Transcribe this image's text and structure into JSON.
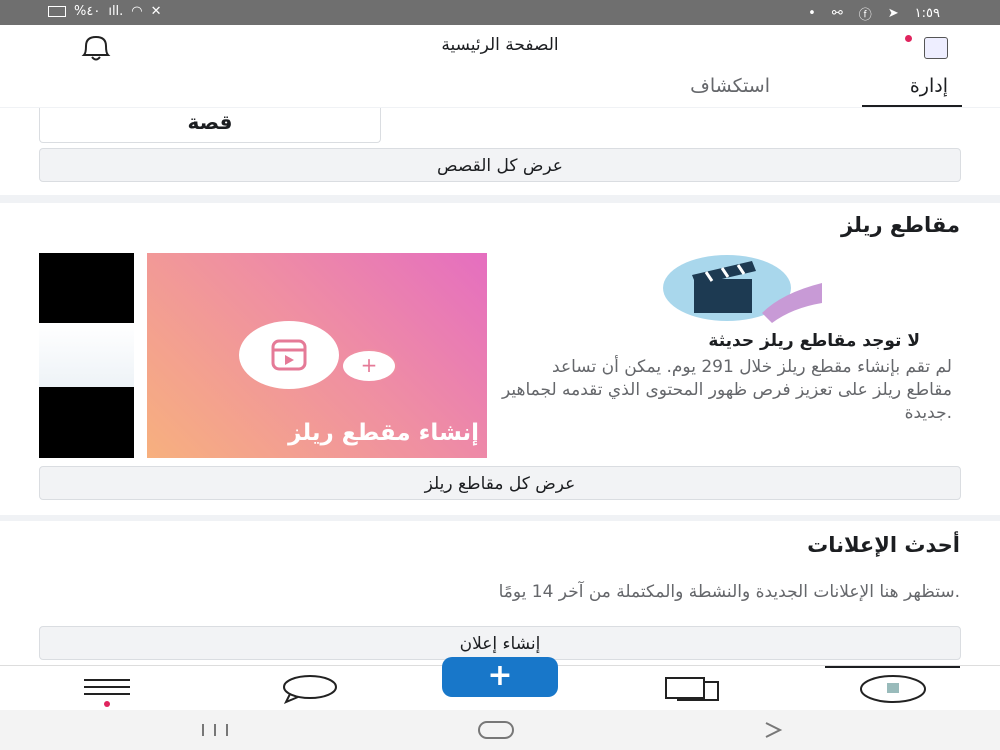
{
  "statusbar": {
    "battery": "%٤٠",
    "signal": "ıll.",
    "time": "١:٥٩"
  },
  "header": {
    "title": "الصفحة الرئيسية"
  },
  "tabs": [
    {
      "label": "إدارة",
      "active": true
    },
    {
      "label": "استكشاف",
      "active": false
    }
  ],
  "stories": {
    "story_label": "قصة",
    "view_all": "عرض كل القصص"
  },
  "reels": {
    "title": "مقاطع ريلز",
    "create_label": "إنشاء مقطع ريلز",
    "empty_title": "لا توجد مقاطع ريلز حديثة",
    "empty_text": "لم تقم بإنشاء مقطع ريلز خلال 291 يوم. يمكن أن تساعد مقاطع ريلز على تعزيز فرص ظهور المحتوى الذي تقدمه لجماهير جديدة.",
    "view_all": "عرض كل مقاطع ريلز"
  },
  "ads": {
    "title": "أحدث الإعلانات",
    "text": "ستظهر هنا الإعلانات الجديدة والنشطة والمكتملة من آخر 14 يومًا.",
    "create": "إنشاء إعلان"
  },
  "fab": {
    "label": "+"
  },
  "colors": {
    "accent": "#1877c9",
    "notification": "#e0245e"
  }
}
